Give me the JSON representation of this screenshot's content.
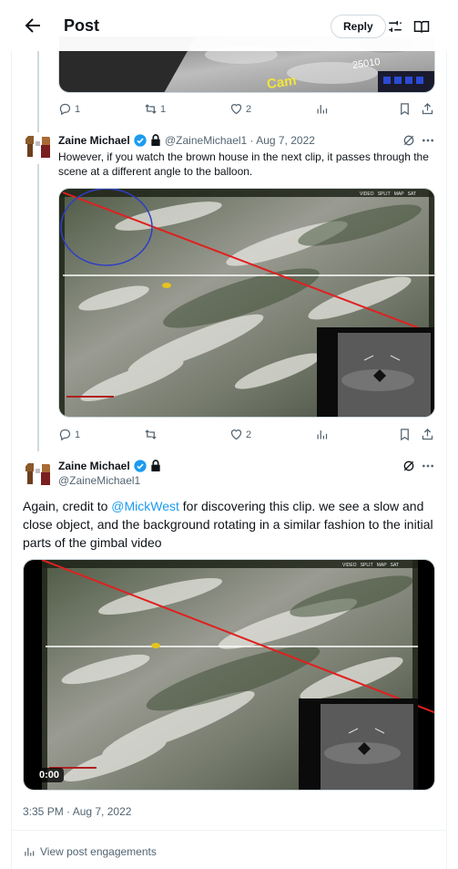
{
  "header": {
    "title": "Post",
    "reply_label": "Reply"
  },
  "top_tweet": {
    "media_overlay_text": "Cam",
    "media_number": "25010",
    "actions": {
      "replies": "1",
      "retweets": "1",
      "likes": "2",
      "views": ""
    }
  },
  "tweet1": {
    "author_name": "Zaine Michael",
    "handle_date": "@ZaineMichael1 · Aug 7, 2022",
    "text": "However, if you watch the brown house in the next clip, it passes through the scene at a different angle to the balloon.",
    "media_hud": "VIDEO   SPLIT   MAP   SAT",
    "actions": {
      "replies": "1",
      "retweets": "",
      "likes": "2",
      "views": ""
    }
  },
  "main_tweet": {
    "author_name": "Zaine Michael",
    "handle": "@ZaineMichael1",
    "text_before": "Again, credit to ",
    "mention": "@MickWest",
    "text_after": " for discovering this clip. we see a slow and close object, and the background rotating in a similar fashion to the initial parts of the  gimbal video",
    "media_hud": "VIDEO   SPLIT   MAP   SAT",
    "video_time": "0:00",
    "timestamp": "3:35 PM · Aug 7, 2022",
    "engagements_label": "View post engagements"
  },
  "colors": {
    "accent": "#1d9bf0",
    "secondary_text": "#536471",
    "red_line": "#e0201f"
  }
}
